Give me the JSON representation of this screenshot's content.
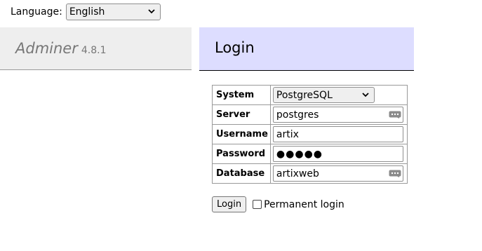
{
  "language": {
    "label": "Language:",
    "selected": "English"
  },
  "brand": {
    "name": "Adminer",
    "version": "4.8.1"
  },
  "page": {
    "title": "Login"
  },
  "form": {
    "system": {
      "label": "System",
      "value": "PostgreSQL"
    },
    "server": {
      "label": "Server",
      "value": "postgres"
    },
    "username": {
      "label": "Username",
      "value": "artix"
    },
    "password": {
      "label": "Password",
      "value": "●●●●●"
    },
    "database": {
      "label": "Database",
      "value": "artixweb"
    }
  },
  "actions": {
    "login_label": "Login",
    "permanent_label": "Permanent login"
  },
  "icons": {
    "chevron": "chevron-down-icon",
    "datalist": "more-options-icon"
  }
}
